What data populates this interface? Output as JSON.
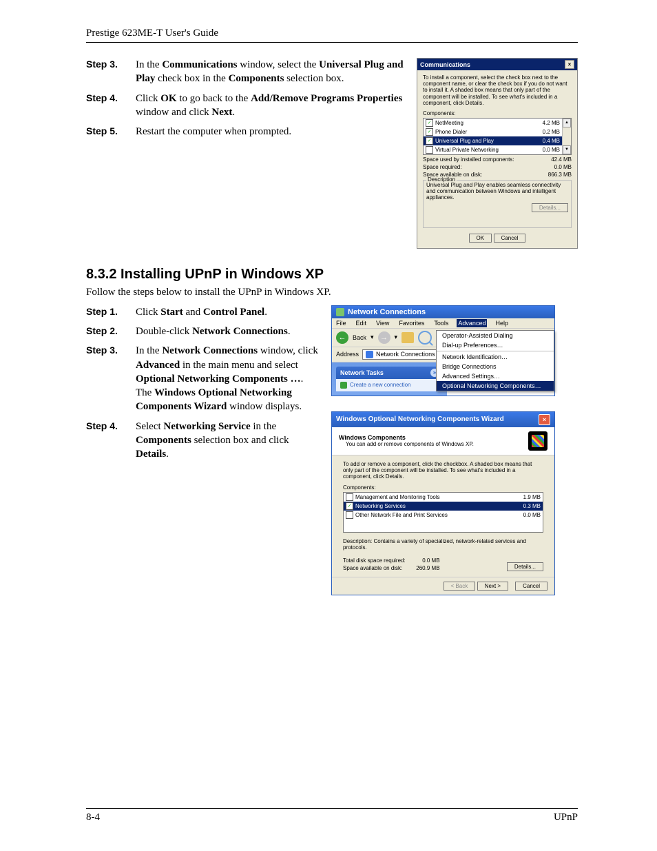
{
  "header": {
    "title": "Prestige 623ME-T User's Guide"
  },
  "section1": {
    "steps": [
      {
        "label": "Step 3.",
        "prefix": "In the ",
        "b1": "Communications",
        "mid1": " window, select the ",
        "b2": "Universal Plug and Play",
        "mid2": " check box in the ",
        "b3": "Components",
        "suffix": " selection box."
      },
      {
        "label": "Step 4.",
        "prefix": "Click ",
        "b1": "OK",
        "mid1": " to go back to the ",
        "b2": "Add/Remove Programs Properties",
        "mid2": " window and click ",
        "b3": "Next",
        "suffix": "."
      },
      {
        "label": "Step 5.",
        "text": "Restart the computer when prompted."
      }
    ]
  },
  "dlg1": {
    "title": "Communications",
    "instructions": "To install a component, select the check box next to the component name, or clear the check box if you do not want to install it. A shaded box means that only part of the component will be installed. To see what's included in a component, click Details.",
    "compLabel": "Components:",
    "rows": [
      {
        "checked": true,
        "name": "NetMeeting",
        "size": "4.2 MB"
      },
      {
        "checked": true,
        "name": "Phone Dialer",
        "size": "0.2 MB"
      },
      {
        "checked": true,
        "name": "Universal Plug and Play",
        "size": "0.4 MB",
        "selected": true
      },
      {
        "checked": false,
        "name": "Virtual Private Networking",
        "size": "0.0 MB"
      }
    ],
    "stats": [
      {
        "k": "Space used by installed components:",
        "v": "42.4 MB"
      },
      {
        "k": "Space required:",
        "v": "0.0 MB"
      },
      {
        "k": "Space available on disk:",
        "v": "866.3 MB"
      }
    ],
    "descLabel": "Description",
    "desc": "Universal Plug and Play enables seamless connectivity and communication between Windows and intelligent appliances.",
    "detailsBtn": "Details...",
    "ok": "OK",
    "cancel": "Cancel"
  },
  "section2": {
    "heading": "8.3.2   Installing UPnP in Windows XP",
    "intro": "Follow the steps below to install the UPnP in Windows XP.",
    "steps": [
      {
        "label": "Step 1.",
        "prefix": "Click ",
        "b1": "Start",
        "mid1": " and ",
        "b2": "Control Panel",
        "suffix": "."
      },
      {
        "label": "Step 2.",
        "prefix": "Double-click ",
        "b1": "Network Connections",
        "suffix": "."
      },
      {
        "label": "Step 3.",
        "prefix": "In the ",
        "b1": "Network Connections",
        "mid1": " window, click ",
        "b2": "Advanced",
        "mid2": " in the main menu and select ",
        "b3": "Optional Networking Components …",
        "suffix": ".",
        "line2a": "The ",
        "line2b": "Windows Optional Networking Components Wizard",
        "line2c": " window displays."
      },
      {
        "label": "Step 4.",
        "prefix": "Select ",
        "b1": "Networking Service",
        "mid1": " in the ",
        "b2": "Components",
        "mid2": " selection box and click ",
        "b3": "Details",
        "suffix": "."
      }
    ]
  },
  "win2": {
    "title": "Network Connections",
    "menus": [
      "File",
      "Edit",
      "View",
      "Favorites",
      "Tools",
      "Advanced",
      "Help"
    ],
    "openMenu": "Advanced",
    "ctxItems": [
      {
        "t": "Operator-Assisted Dialing"
      },
      {
        "t": "Dial-up Preferences…"
      },
      {
        "sep": true
      },
      {
        "t": "Network Identification…"
      },
      {
        "t": "Bridge Connections"
      },
      {
        "t": "Advanced Settings…"
      },
      {
        "t": "Optional Networking Components…",
        "hl": true
      }
    ],
    "back": "Back",
    "addrLabel": "Address",
    "addrValue": "Network Connections",
    "taskTitle": "Network Tasks",
    "taskLink": "Create a new connection",
    "searchHint": "Se"
  },
  "dlg3": {
    "title": "Windows Optional Networking Components Wizard",
    "head1": "Windows Components",
    "head2": "You can add or remove components of Windows XP.",
    "instructions": "To add or remove a component, click the checkbox. A shaded box means that only part of the component will be installed. To see what's included in a component, click Details.",
    "compLabel": "Components:",
    "rows": [
      {
        "checked": false,
        "name": "Management and Monitoring Tools",
        "size": "1.9 MB"
      },
      {
        "checked": true,
        "name": "Networking Services",
        "size": "0.3 MB",
        "selected": true
      },
      {
        "checked": false,
        "name": "Other Network File and Print Services",
        "size": "0.0 MB"
      }
    ],
    "descLabel": "Description:",
    "desc": "Contains a variety of specialized, network-related services and protocols.",
    "stat1k": "Total disk space required:",
    "stat1v": "0.0 MB",
    "stat2k": "Space available on disk:",
    "stat2v": "260.9 MB",
    "detailsBtn": "Details...",
    "backBtn": "< Back",
    "nextBtn": "Next >",
    "cancelBtn": "Cancel"
  },
  "footer": {
    "left": "8-4",
    "right": "UPnP"
  }
}
